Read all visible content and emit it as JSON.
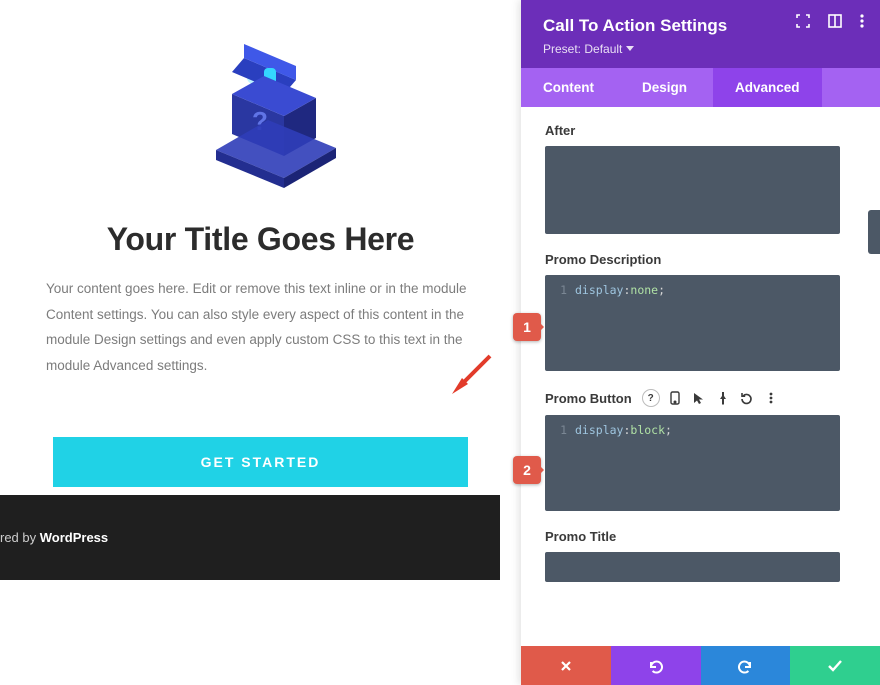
{
  "preview": {
    "title": "Your Title Goes Here",
    "description": "Your content goes here. Edit or remove this text inline or in the module Content settings. You can also style every aspect of this content in the module Design settings and even apply custom CSS to this text in the module Advanced settings.",
    "button_label": "GET STARTED",
    "footer_prefix": "red by ",
    "footer_brand": "WordPress",
    "icon": "question-box-icon"
  },
  "panel": {
    "title": "Call To Action Settings",
    "preset_label": "Preset: Default",
    "tabs": {
      "content": "Content",
      "design": "Design",
      "advanced": "Advanced",
      "active": "advanced"
    },
    "header_icons": [
      "expand-icon",
      "columns-icon",
      "more-icon"
    ],
    "sections": [
      {
        "label": "After",
        "code": ""
      },
      {
        "label": "Promo Description",
        "code_key": "display",
        "code_val": "none"
      },
      {
        "label": "Promo Button",
        "code_key": "display",
        "code_val": "block",
        "show_opts": true
      },
      {
        "label": "Promo Title",
        "code": ""
      }
    ],
    "opt_icons": [
      "help-icon",
      "phone-icon",
      "cursor-icon",
      "pin-icon",
      "reset-icon",
      "more-icon"
    ],
    "footer_icons": [
      "close-icon",
      "undo-icon",
      "redo-icon",
      "check-icon"
    ]
  },
  "callouts": {
    "one": "1",
    "two": "2"
  },
  "colors": {
    "accent_button": "#20d2e6",
    "panel_header": "#6c2eb9",
    "tab_bar": "#a462f2",
    "tab_active": "#8e43ea",
    "code_bg": "#4c5866",
    "callout": "#e05a4a",
    "footer_ok": "#2fcf8f",
    "footer_redo": "#2b87da"
  }
}
